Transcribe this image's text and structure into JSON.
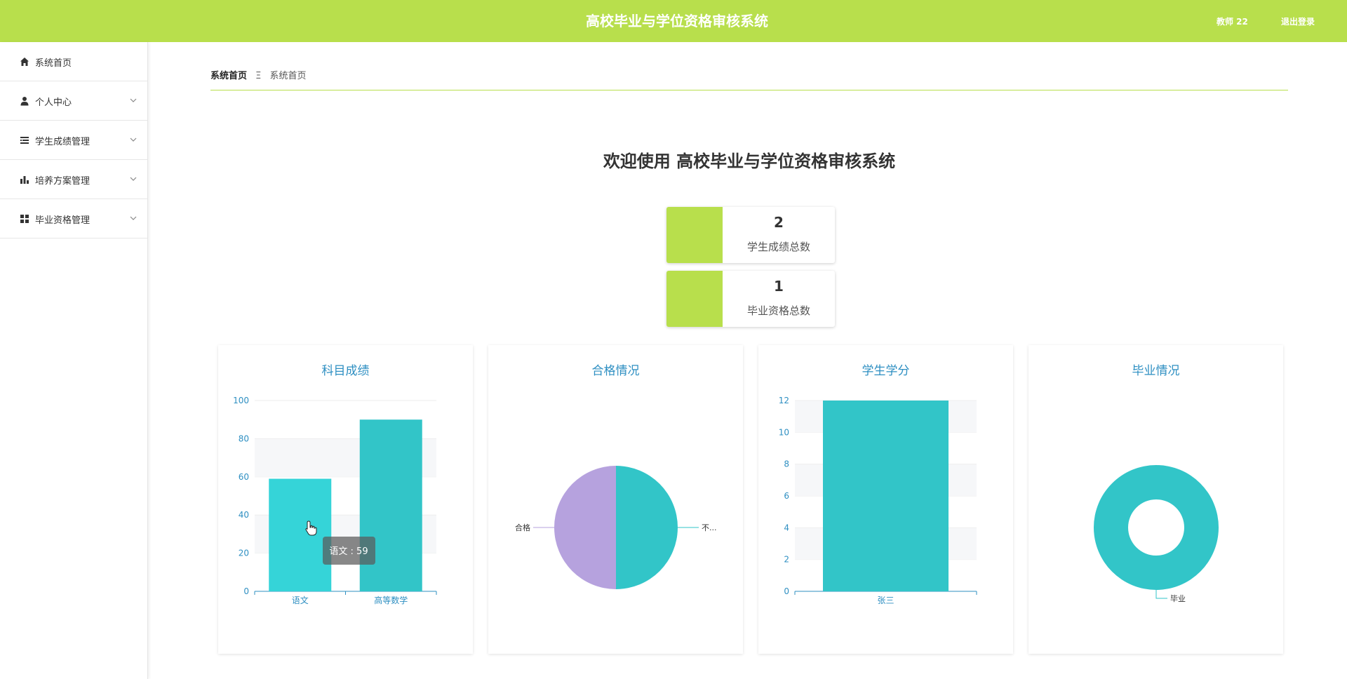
{
  "header": {
    "title": "高校毕业与学位资格审核系统",
    "user": "教师 22",
    "logout": "退出登录"
  },
  "sidebar": {
    "items": [
      {
        "label": "系统首页",
        "icon": "home-icon"
      },
      {
        "label": "个人中心",
        "icon": "user-icon"
      },
      {
        "label": "学生成绩管理",
        "icon": "list-icon"
      },
      {
        "label": "培养方案管理",
        "icon": "bar-chart-icon"
      },
      {
        "label": "毕业资格管理",
        "icon": "grid-icon"
      }
    ]
  },
  "breadcrumb": {
    "home": "系统首页",
    "separator": "Ξ",
    "current": "系统首页"
  },
  "welcome": "欢迎使用 高校毕业与学位资格审核系统",
  "stats": [
    {
      "value": "2",
      "label": "学生成绩总数"
    },
    {
      "value": "1",
      "label": "毕业资格总数"
    }
  ],
  "colors": {
    "accent": "#b8df4c",
    "teal": "#32c5c8",
    "purple": "#b6a2de",
    "title_blue": "#2e8fc2"
  },
  "chart_data": [
    {
      "type": "bar",
      "title": "科目成绩",
      "categories": [
        "语文",
        "高等数学"
      ],
      "values": [
        59,
        90
      ],
      "ylim": [
        0,
        100
      ],
      "yticks": [
        0,
        20,
        40,
        60,
        80,
        100
      ],
      "tooltip": "语文 : 59"
    },
    {
      "type": "pie",
      "title": "合格情况",
      "labels": [
        "合格",
        "不..."
      ],
      "values": [
        1,
        1
      ]
    },
    {
      "type": "bar",
      "title": "学生学分",
      "categories": [
        "张三"
      ],
      "values": [
        12
      ],
      "ylim": [
        0,
        12
      ],
      "yticks": [
        0,
        2,
        4,
        6,
        8,
        10,
        12
      ]
    },
    {
      "type": "pie",
      "title": "毕业情况",
      "labels": [
        "毕业"
      ],
      "values": [
        1
      ],
      "donut": true
    }
  ]
}
